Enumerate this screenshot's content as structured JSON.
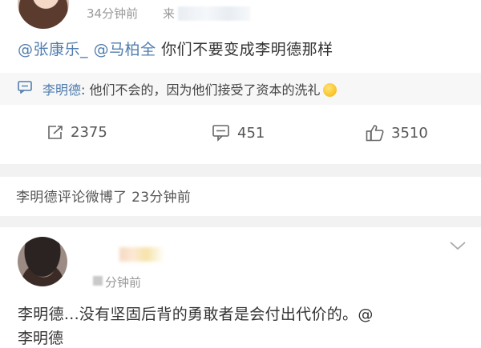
{
  "post1": {
    "time": "34分钟前",
    "source_prefix": "来",
    "mention_1": "@张康乐_",
    "mention_2": "@马柏全",
    "text": "你们不要变成李明德那样",
    "reply": {
      "name": "李明德",
      "text": ": 他们不会的，因为他们接受了资本的洗礼"
    },
    "actions": {
      "repost_count": "2375",
      "comment_count": "451",
      "like_count": "3510"
    }
  },
  "activity": {
    "text": "李明德评论微博了 23分钟前"
  },
  "post2": {
    "time": "分钟前",
    "text": "李明德...没有坚固后背的勇敢者是会付出代价的。@",
    "line2": "李明德"
  },
  "colors": {
    "link": "#507daf",
    "band": "#f2f2f2",
    "reply_bg": "#f7f7f7"
  }
}
